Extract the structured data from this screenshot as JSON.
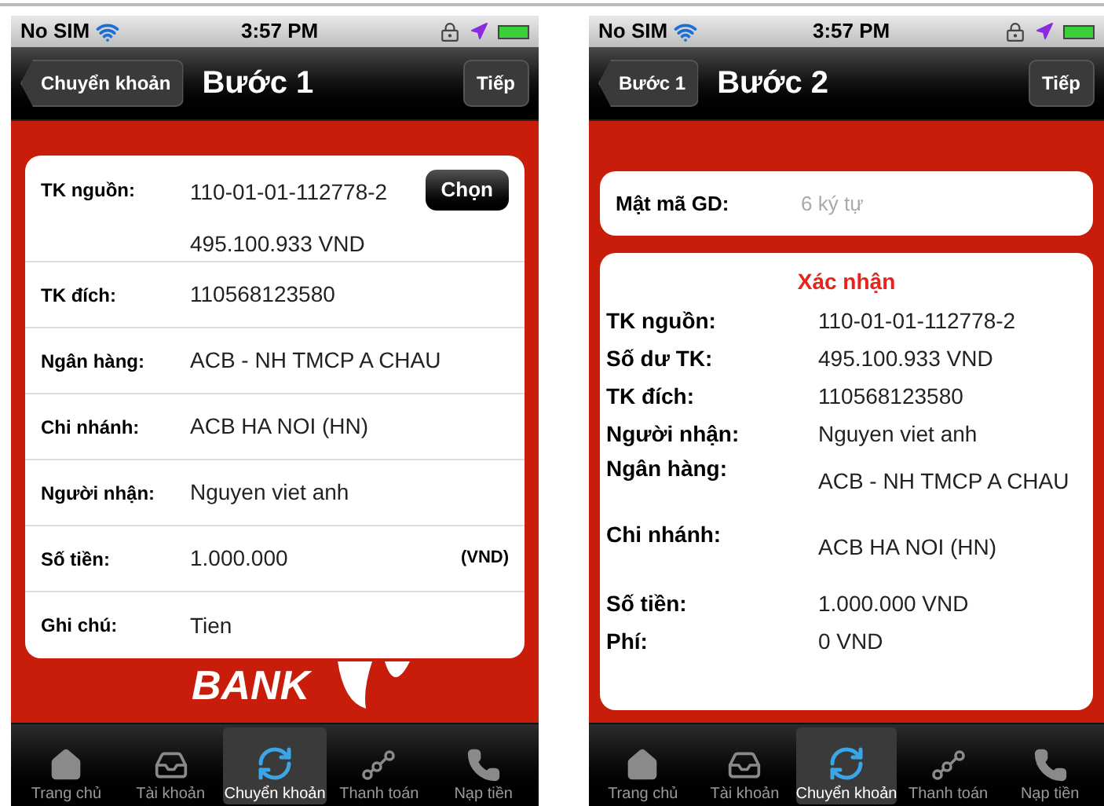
{
  "screens": [
    {
      "status_bar": {
        "carrier": "No SIM",
        "time": "3:57 PM"
      },
      "nav": {
        "back": "Chuyển khoản",
        "title": "Bước 1",
        "next": "Tiếp"
      },
      "form": {
        "rows": [
          {
            "kind": "account",
            "label": "TK nguồn:",
            "value": "110-01-01-112778-2",
            "balance": "495.100.933 VND",
            "button": "Chọn"
          },
          {
            "kind": "text",
            "label": "TK đích:",
            "value": "110568123580"
          },
          {
            "kind": "text",
            "label": "Ngân hàng:",
            "value": "ACB - NH TMCP A CHAU"
          },
          {
            "kind": "text",
            "label": "Chi nhánh:",
            "value": "ACB HA NOI (HN)"
          },
          {
            "kind": "text",
            "label": "Người nhận:",
            "value": "Nguyen viet anh"
          },
          {
            "kind": "amount",
            "label": "Số tiền:",
            "value": "1.000.000",
            "unit": "(VND)"
          },
          {
            "kind": "text",
            "label": "Ghi chú:",
            "value": "Tien"
          }
        ]
      },
      "logo": "BANK",
      "tab_bar": [
        {
          "label": "Trang chủ",
          "selected": false
        },
        {
          "label": "Tài khoản",
          "selected": false
        },
        {
          "label": "Chuyển khoản",
          "selected": true
        },
        {
          "label": "Thanh toán",
          "selected": false
        },
        {
          "label": "Nạp tiền",
          "selected": false
        }
      ]
    },
    {
      "status_bar": {
        "carrier": "No SIM",
        "time": "3:57 PM"
      },
      "nav": {
        "back": "Bước 1",
        "title": "Bước 2",
        "next": "Tiếp"
      },
      "password": {
        "label": "Mật mã GD:",
        "placeholder": "6 ký tự"
      },
      "confirm": {
        "title": "Xác nhận",
        "rows": [
          {
            "label": "TK nguồn:",
            "value": "110-01-01-112778-2"
          },
          {
            "label": "Số dư TK:",
            "value": "495.100.933 VND"
          },
          {
            "label": "TK đích:",
            "value": "110568123580"
          },
          {
            "label": "Người nhận:",
            "value": "Nguyen viet anh"
          },
          {
            "label": "Ngân hàng:",
            "value": "ACB - NH TMCP A CHAU"
          },
          {
            "label": "Chi nhánh:",
            "value": "ACB HA NOI (HN)"
          },
          {
            "label": "Số tiền:",
            "value": "1.000.000 VND"
          },
          {
            "label": "Phí:",
            "value": "0 VND"
          }
        ]
      },
      "tab_bar": [
        {
          "label": "Trang chủ",
          "selected": false
        },
        {
          "label": "Tài khoản",
          "selected": false
        },
        {
          "label": "Chuyển khoản",
          "selected": true
        },
        {
          "label": "Thanh toán",
          "selected": false
        },
        {
          "label": "Nạp tiền",
          "selected": false
        }
      ]
    }
  ]
}
